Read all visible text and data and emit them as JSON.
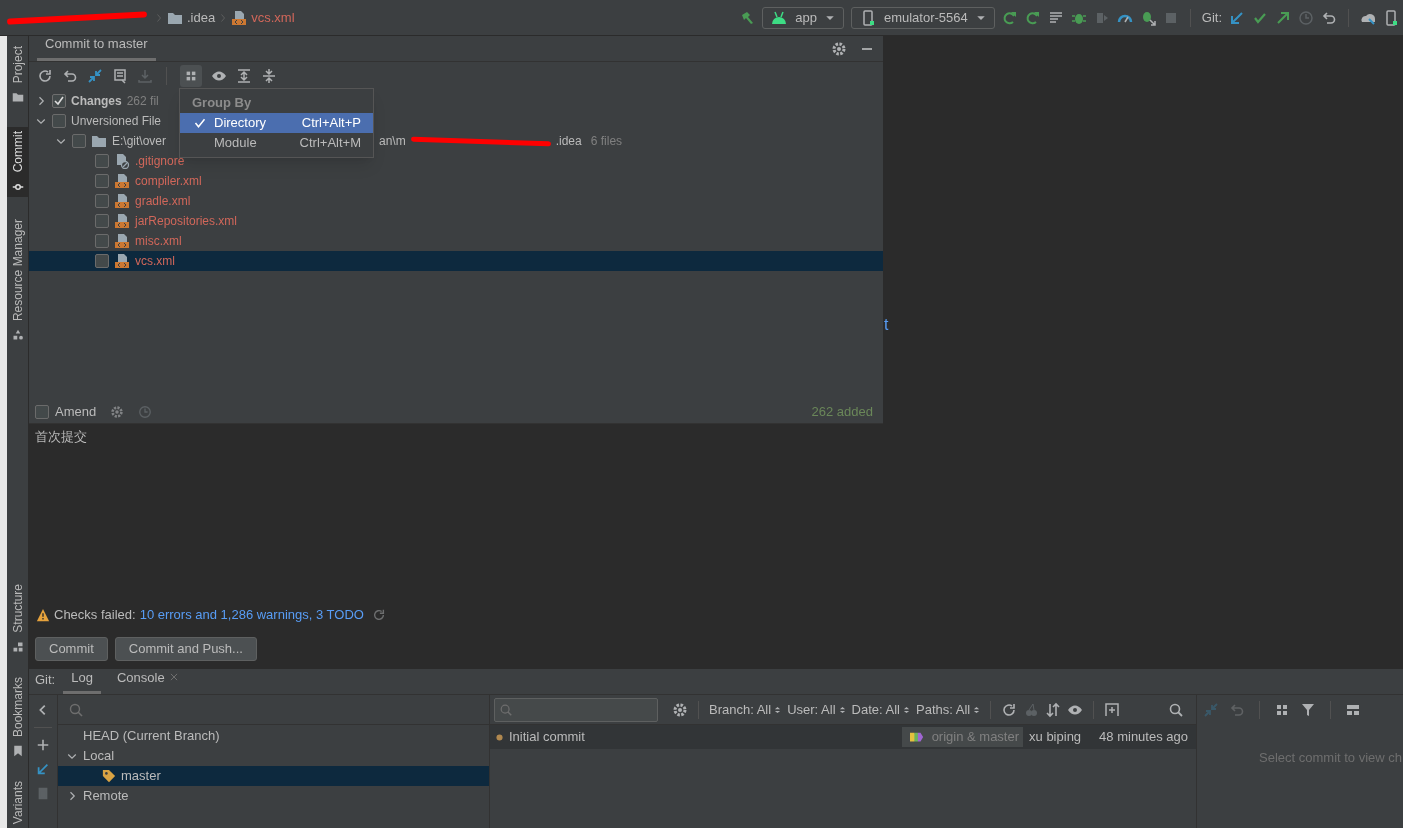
{
  "breadcrumb": [
    {
      "text": ".idea",
      "kind": "folder"
    },
    {
      "text": "vcs.xml",
      "kind": "xml"
    }
  ],
  "toolbar": {
    "run_config": "app",
    "device": "emulator-5564",
    "git_label": "Git:"
  },
  "side_tabs": [
    {
      "label": "Project",
      "selected": false,
      "kind": "folder"
    },
    {
      "label": "Commit",
      "selected": true,
      "kind": "commit"
    },
    {
      "label": "Resource Manager",
      "selected": false,
      "kind": "shapes"
    },
    {
      "label": "Structure",
      "selected": false,
      "kind": "structure"
    },
    {
      "label": "Bookmarks",
      "selected": false,
      "kind": "bookmark"
    },
    {
      "label": "Variants",
      "selected": false,
      "kind": "none"
    }
  ],
  "commit_panel": {
    "title": "Commit to master",
    "tree": [
      {
        "label": "Changes",
        "count": "262 fil",
        "checked": true,
        "expanded": false
      },
      {
        "label": "Unversioned File",
        "checked": false,
        "expanded": true,
        "children": [
          {
            "path_start": "E:\\git\\over",
            "path_middle": "an\\m",
            "path_end": ".idea",
            "count": "6 files",
            "checked": false,
            "expanded": true,
            "children": [
              {
                "name": ".gitignore",
                "kind": "ignore",
                "checked": false,
                "selected": false
              },
              {
                "name": "compiler.xml",
                "kind": "xml",
                "checked": false,
                "selected": false
              },
              {
                "name": "gradle.xml",
                "kind": "xml",
                "checked": false,
                "selected": false
              },
              {
                "name": "jarRepositories.xml",
                "kind": "xml",
                "checked": false,
                "selected": false
              },
              {
                "name": "misc.xml",
                "kind": "xml",
                "checked": false,
                "selected": false
              },
              {
                "name": "vcs.xml",
                "kind": "xml",
                "checked": false,
                "selected": true
              }
            ]
          }
        ]
      }
    ],
    "group_by_popup": {
      "title": "Group By",
      "items": [
        {
          "label": "Directory",
          "shortcut": "Ctrl+Alt+P",
          "selected": true
        },
        {
          "label": "Module",
          "shortcut": "Ctrl+Alt+M",
          "selected": false
        }
      ]
    },
    "amend": {
      "label": "Amend",
      "checked": false
    },
    "added": "262 added",
    "message": "首次提交",
    "checks": {
      "prefix": "Checks failed:",
      "link": "10 errors and 1,286 warnings, 3 TODO"
    },
    "buttons": [
      "Commit",
      "Commit and Push..."
    ]
  },
  "editor_fragment": "t",
  "git_panel": {
    "label": "Git:",
    "tabs": [
      {
        "label": "Log",
        "selected": true,
        "closable": false
      },
      {
        "label": "Console",
        "selected": false,
        "closable": true
      }
    ],
    "branches": [
      {
        "label": "HEAD (Current Branch)",
        "selected": false
      },
      {
        "label": "Local",
        "expanded": true,
        "selected": false,
        "children": [
          {
            "label": "master",
            "selected": true
          }
        ]
      },
      {
        "label": "Remote",
        "expanded": false,
        "selected": false
      }
    ],
    "filters": [
      "Branch: All",
      "User: All",
      "Date: All",
      "Paths: All"
    ],
    "commits": [
      {
        "message": "Initial commit",
        "refs": "origin & master",
        "author": "xu biping",
        "time": "48 minutes ago"
      }
    ],
    "details_hint": "Select commit to view ch"
  }
}
